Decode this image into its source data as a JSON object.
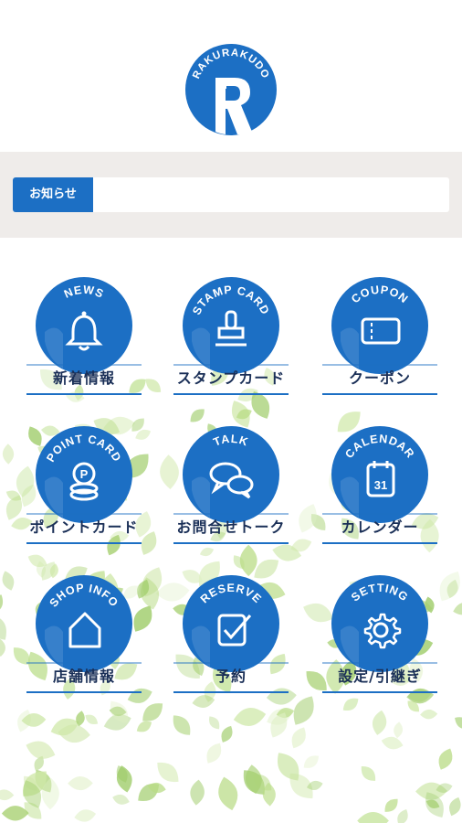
{
  "logo": {
    "brand_text": "RAKURAKUDO",
    "letter": "R"
  },
  "notice": {
    "label": "お知らせ",
    "text": ""
  },
  "menu": [
    {
      "id": "news",
      "badge": "NEWS",
      "label": "新着情報",
      "icon": "bell-icon"
    },
    {
      "id": "stamp",
      "badge": "STAMP CARD",
      "label": "スタンプカード",
      "icon": "stamp-icon"
    },
    {
      "id": "coupon",
      "badge": "COUPON",
      "label": "クーポン",
      "icon": "ticket-icon"
    },
    {
      "id": "point",
      "badge": "POINT CARD",
      "label": "ポイントカード",
      "icon": "coins-icon"
    },
    {
      "id": "talk",
      "badge": "TALK",
      "label": "お問合せトーク",
      "icon": "chat-bubbles-icon"
    },
    {
      "id": "calendar",
      "badge": "CALENDAR",
      "label": "カレンダー",
      "icon": "calendar-icon",
      "icon_text": "31"
    },
    {
      "id": "shop",
      "badge": "SHOP INFO",
      "label": "店舗情報",
      "icon": "house-icon"
    },
    {
      "id": "reserve",
      "badge": "RESERVE",
      "label": "予約",
      "icon": "checkbox-icon"
    },
    {
      "id": "setting",
      "badge": "SETTING",
      "label": "設定/引継ぎ",
      "icon": "gear-icon"
    }
  ],
  "colors": {
    "primary": "#1c6fc4",
    "label_text": "#1a2f57",
    "notice_bg": "#efecea"
  }
}
